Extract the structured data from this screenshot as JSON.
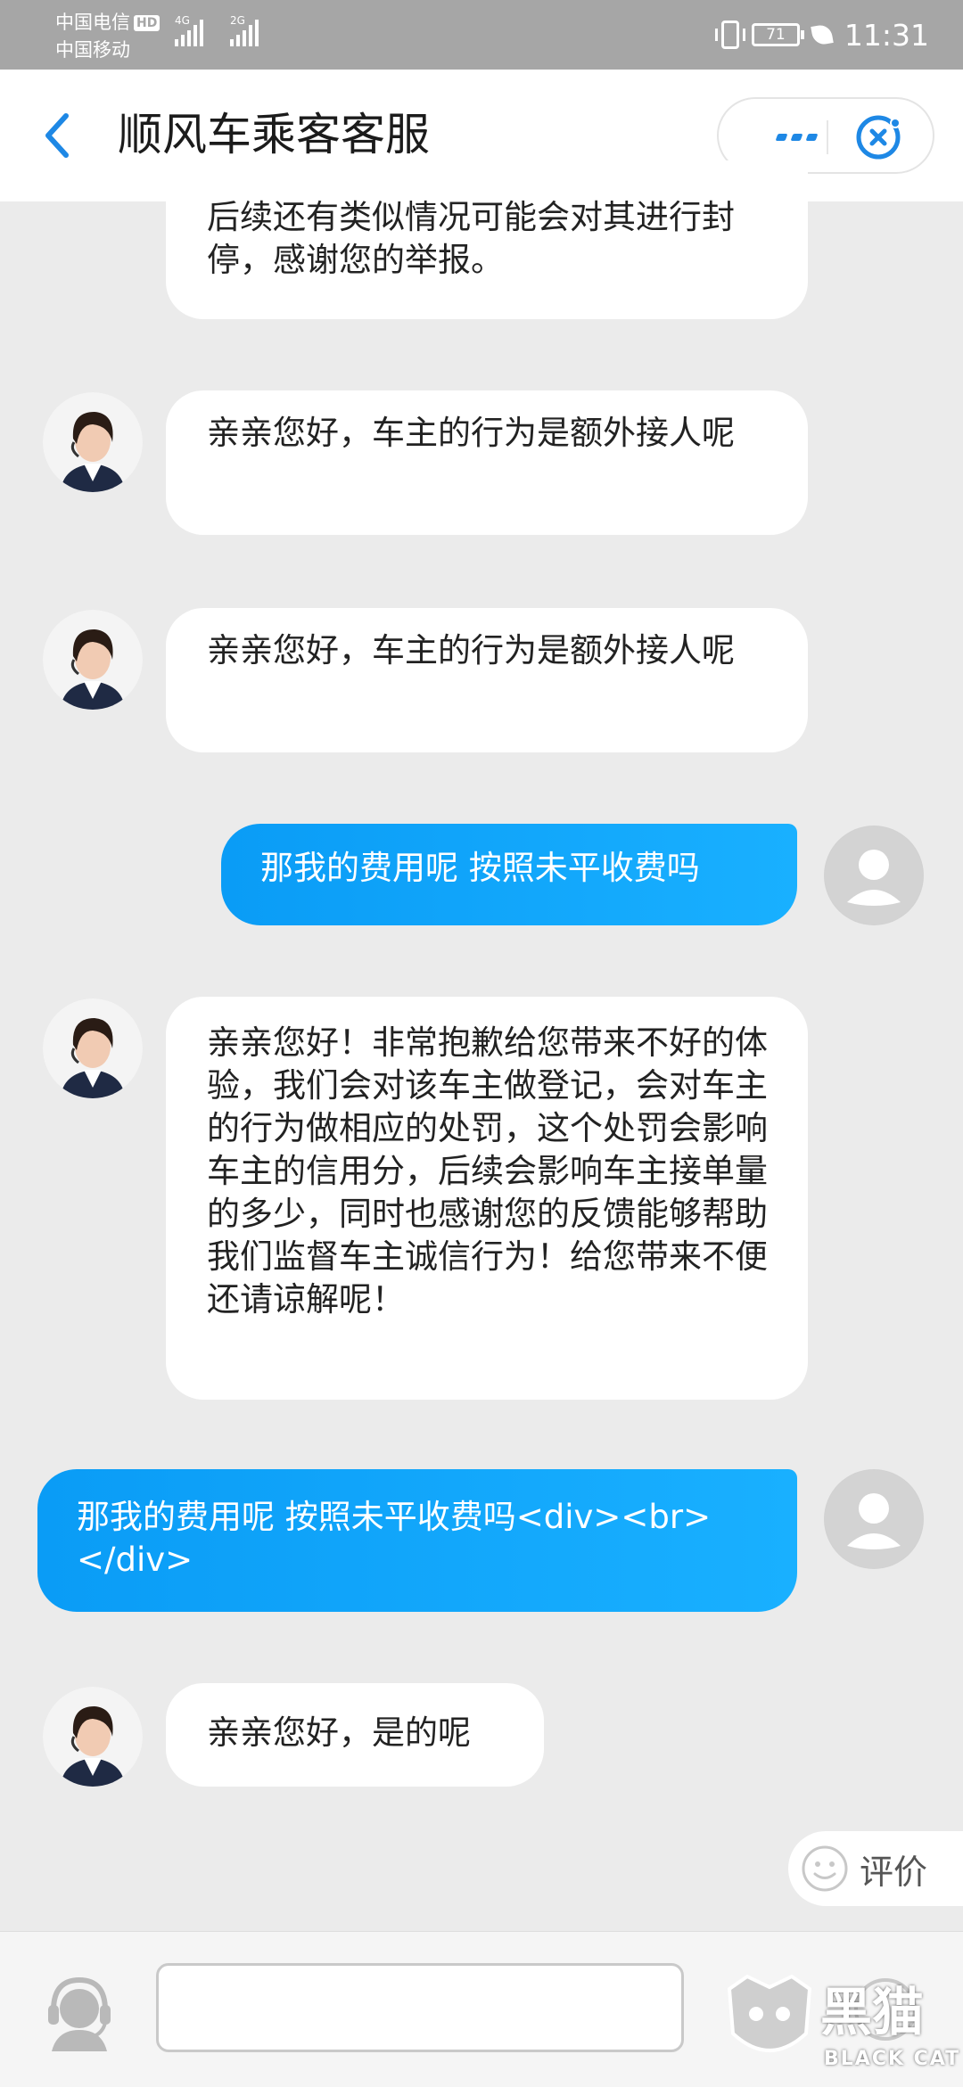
{
  "status_bar": {
    "carrier_1": "中国电信",
    "hd_badge": "HD",
    "carrier_2": "中国移动",
    "net_1": "4G",
    "net_2": "2G",
    "battery": "71",
    "time": "11:31"
  },
  "header": {
    "title": "顺风车乘客客服"
  },
  "messages": [
    {
      "from": "agent",
      "text": "后续还有类似情况可能会对其进行封停，感谢您的举报。"
    },
    {
      "from": "agent",
      "text": "亲亲您好，车主的行为是额外接人呢"
    },
    {
      "from": "agent",
      "text": "亲亲您好，车主的行为是额外接人呢"
    },
    {
      "from": "user",
      "text": "那我的费用呢 按照未平收费吗"
    },
    {
      "from": "agent",
      "text": "亲亲您好！非常抱歉给您带来不好的体验，我们会对该车主做登记，会对车主的行为做相应的处罚，这个处罚会影响车主的信用分，后续会影响车主接单量的多少，同时也感谢您的反馈能够帮助我们监督车主诚信行为！给您带来不便还请谅解呢！"
    },
    {
      "from": "user",
      "text": "那我的费用呢 按照未平收费吗<div><br></div>"
    },
    {
      "from": "agent",
      "text": "亲亲您好，是的呢"
    }
  ],
  "rating": {
    "label": "评价"
  },
  "watermark": {
    "text": "黑猫",
    "sub": "BLACK CAT"
  },
  "colors": {
    "accent": "#1e88e5",
    "user_bubble": "#0a9cf6"
  }
}
